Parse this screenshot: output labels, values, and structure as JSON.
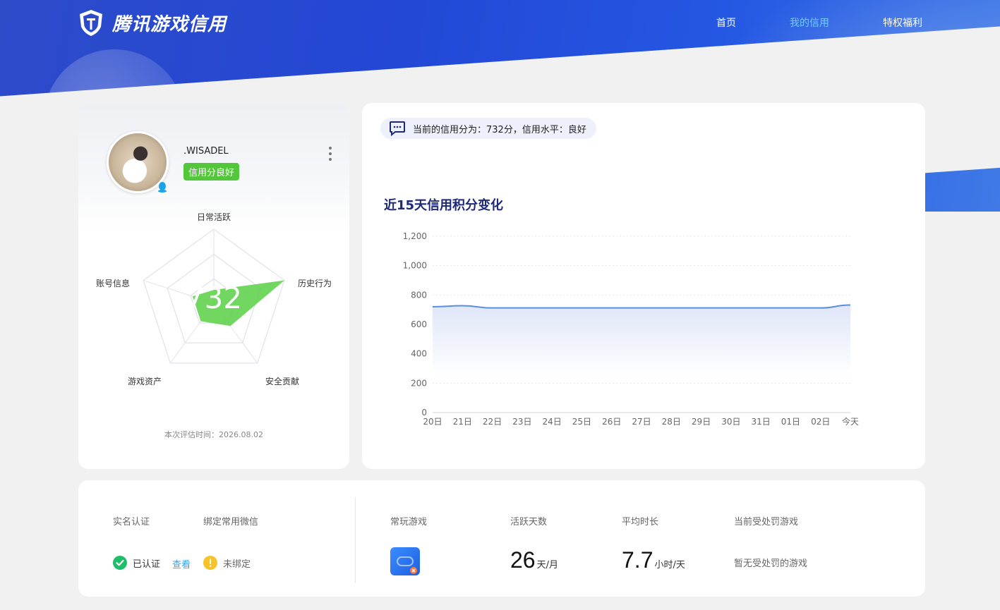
{
  "header": {
    "logo_text": "腾讯游戏信用",
    "nav": [
      {
        "label": "首页",
        "active": false
      },
      {
        "label": "我的信用",
        "active": true
      },
      {
        "label": "特权福利",
        "active": false
      }
    ]
  },
  "profile": {
    "username": ".WISADEL",
    "credit_badge": "信用分良好",
    "score": "732",
    "radar_labels": [
      "日常活跃",
      "历史行为",
      "安全贡献",
      "游戏资产",
      "账号信息"
    ],
    "radar_values": [
      0.18,
      1.0,
      0.38,
      0.3,
      0.3
    ],
    "eval_time": "本次评估时间：2026.08.02"
  },
  "summary": {
    "text": "当前的信用分为：732分，信用水平：良好"
  },
  "chart_data": {
    "type": "area",
    "title": "近15天信用积分变化",
    "x": [
      "20日",
      "21日",
      "22日",
      "23日",
      "24日",
      "25日",
      "26日",
      "27日",
      "28日",
      "29日",
      "30日",
      "31日",
      "01日",
      "02日",
      "今天"
    ],
    "values": [
      720,
      727,
      712,
      712,
      712,
      712,
      712,
      712,
      712,
      712,
      712,
      712,
      712,
      712,
      732
    ],
    "yticks": [
      "0",
      "200",
      "400",
      "600",
      "800",
      "1,000",
      "1,200"
    ],
    "ylim": [
      0,
      1200
    ],
    "grid": true,
    "colors": {
      "line": "#5b8ee0",
      "fill": "#dfe6f8"
    }
  },
  "bottom": {
    "realname_label": "实名认证",
    "realname_status": "已认证",
    "view_link": "查看",
    "wechat_label": "绑定常用微信",
    "wechat_status": "未绑定",
    "games_label": "常玩游戏",
    "active_days_label": "活跃天数",
    "active_days": "26",
    "active_days_unit": "天/月",
    "avg_time_label": "平均时长",
    "avg_time": "7.7",
    "avg_time_unit": "小时/天",
    "penalty_label": "当前受处罚游戏",
    "penalty_text": "暂无受处罚的游戏"
  }
}
